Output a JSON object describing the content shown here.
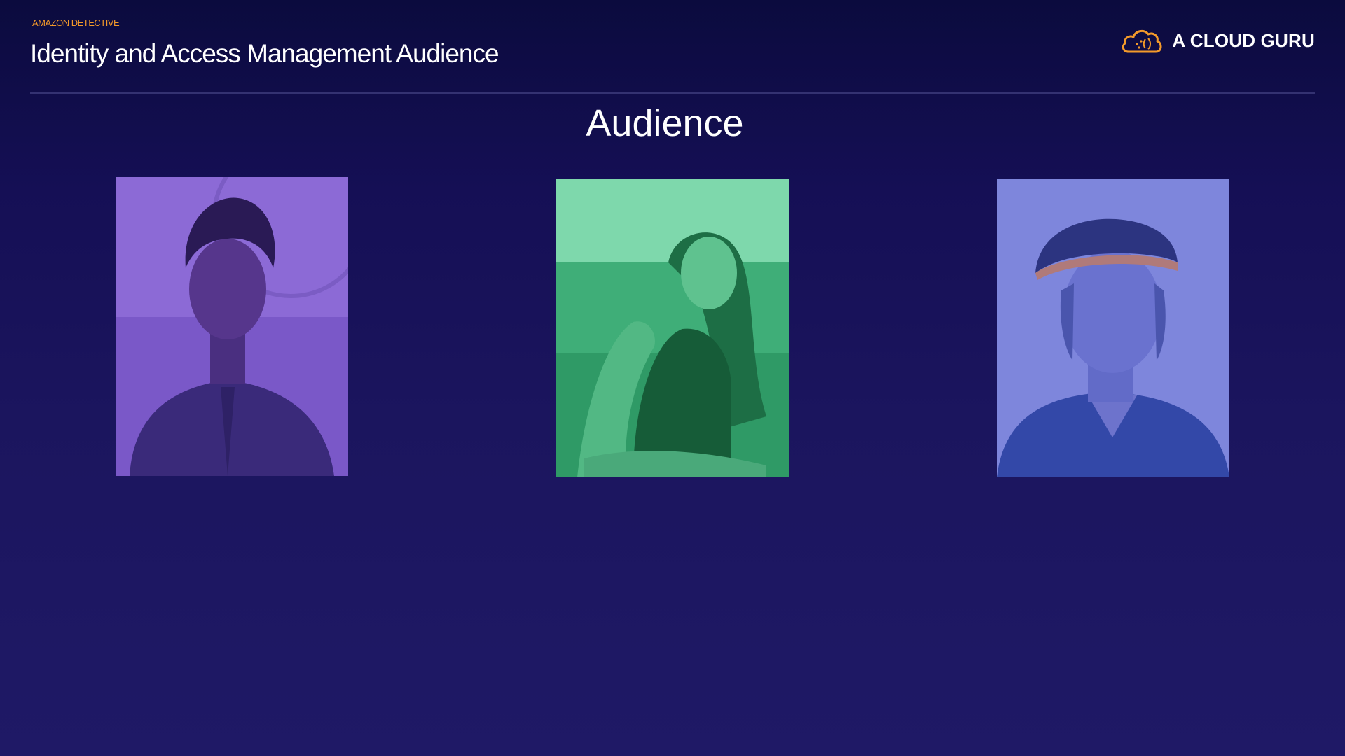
{
  "header": {
    "eyebrow": "AMAZON DETECTIVE",
    "title": "Identity and Access Management Audience"
  },
  "brand": {
    "name": "A CLOUD GURU",
    "icon": "cloud-logo-icon",
    "accent_color": "#f39a2a"
  },
  "main": {
    "heading": "Audience",
    "people": [
      {
        "icon": "person-photo-icon",
        "tint_color": "#8a63d8"
      },
      {
        "icon": "person-photo-icon",
        "tint_color": "#3fbf86"
      },
      {
        "icon": "person-photo-icon",
        "tint_color": "#6f78d8"
      }
    ]
  }
}
